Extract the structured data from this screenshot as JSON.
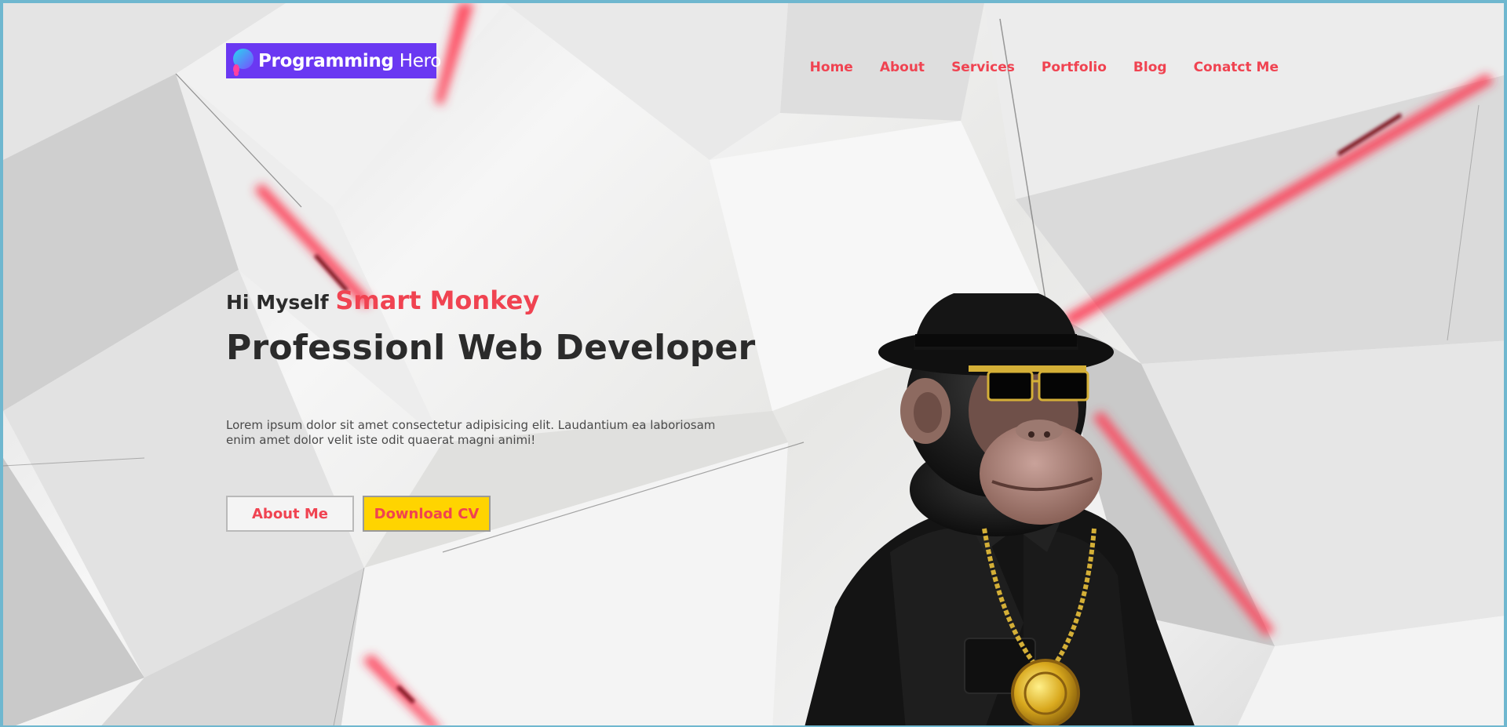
{
  "header": {
    "logo": {
      "bold_text": "Programming",
      "thin_text": " Hero",
      "icon": "rocket-logo-icon",
      "background": "#6a38f2"
    },
    "nav": [
      {
        "label": "Home"
      },
      {
        "label": "About"
      },
      {
        "label": "Services"
      },
      {
        "label": "Portfolio"
      },
      {
        "label": "Blog"
      },
      {
        "label": "Conatct Me"
      }
    ]
  },
  "hero": {
    "greeting_prefix": "Hi Myself",
    "greeting_name": "Smart Monkey",
    "title": "Professionl Web Developer",
    "description": "Lorem ipsum dolor sit amet consectetur adipisicing elit. Laudantium ea laboriosam enim amet dolor velit iste odit quaerat magni animi!",
    "buttons": {
      "about_label": "About Me",
      "cv_label": "Download CV"
    },
    "image": "monkey-portrait-image"
  },
  "colors": {
    "accent": "#f04351",
    "cta_yellow": "#ffd400",
    "text_dark": "#2b2b2b",
    "frame": "#6fb7cf"
  }
}
